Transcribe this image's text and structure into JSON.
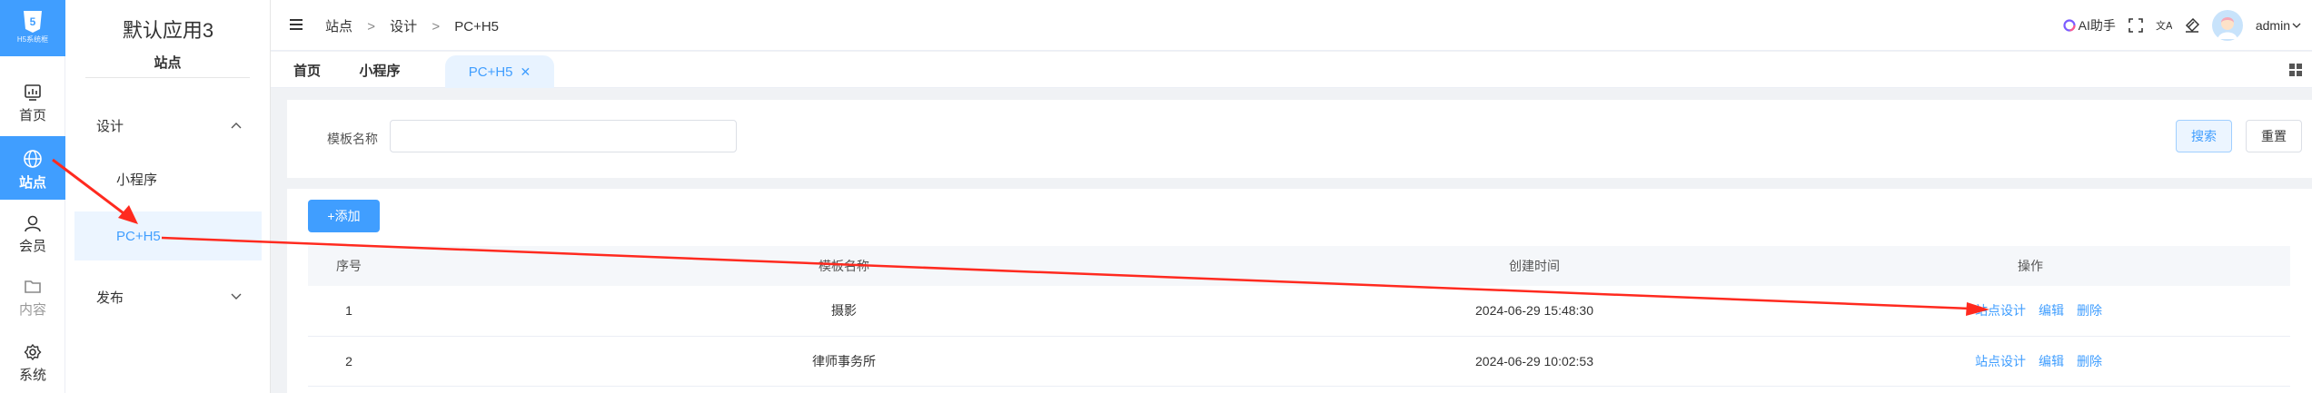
{
  "logo": {
    "text": "5",
    "sub": "H5系统框"
  },
  "rail": [
    {
      "label": "首页",
      "icon": "dashboard-icon",
      "active": false
    },
    {
      "label": "站点",
      "icon": "globe-icon",
      "active": true
    },
    {
      "label": "会员",
      "icon": "user-icon",
      "active": false
    },
    {
      "label": "内容",
      "icon": "folder-icon",
      "active": false
    },
    {
      "label": "系统",
      "icon": "gear-icon",
      "active": false
    }
  ],
  "submenu": {
    "app_title": "默认应用3",
    "section_label": "站点",
    "group_design": "设计",
    "item_miniprogram": "小程序",
    "item_pch5": "PC+H5",
    "group_publish": "发布"
  },
  "header": {
    "breadcrumb": [
      "站点",
      "设计",
      "PC+H5"
    ],
    "breadcrumb_sep": ">",
    "ai_label": "AI助手",
    "user": "admin"
  },
  "tabs": [
    {
      "label": "首页"
    },
    {
      "label": "小程序"
    },
    {
      "label": "PC+H5",
      "closable": true
    }
  ],
  "search": {
    "label": "模板名称",
    "value": "",
    "search_btn": "搜索",
    "reset_btn": "重置"
  },
  "table": {
    "add_btn": "+添加",
    "columns": [
      "序号",
      "模板名称",
      "创建时间",
      "操作"
    ],
    "rows": [
      {
        "idx": "1",
        "name": "摄影",
        "time": "2024-06-29 15:48:30"
      },
      {
        "idx": "2",
        "name": "律师事务所",
        "time": "2024-06-29 10:02:53"
      }
    ],
    "actions": [
      "站点设计",
      "编辑",
      "删除"
    ]
  },
  "colors": {
    "primary": "#409eff",
    "annotation": "#ff2a1f"
  }
}
